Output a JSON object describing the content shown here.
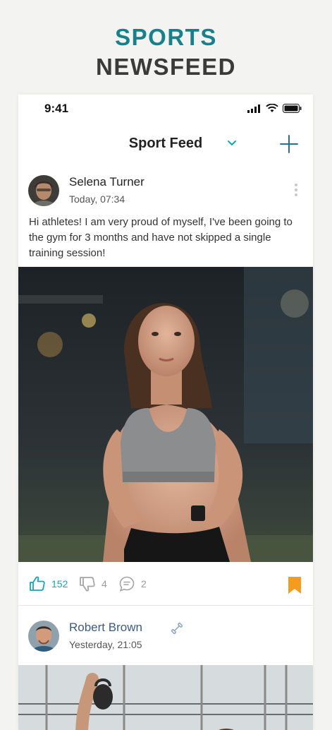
{
  "hero": {
    "line1": "SPORTS",
    "line2": "NEWSFEED"
  },
  "status_bar": {
    "time": "9:41",
    "icons": [
      "cellular-signal-icon",
      "wifi-icon",
      "battery-icon"
    ]
  },
  "nav": {
    "title": "Sport Feed",
    "dropdown_icon": "chevron-down-icon",
    "add_icon": "plus-icon"
  },
  "posts": [
    {
      "author": "Selena Turner",
      "timestamp": "Today, 07:34",
      "text": "Hi athletes! I am very proud of myself, I've been going to the gym for 3 months and have not skipped a single training session!",
      "likes": "152",
      "dislikes": "4",
      "comments": "2",
      "bookmarked": true
    },
    {
      "author": "Robert Brown",
      "timestamp": "Yesterday, 21:05",
      "badge_icon": "dumbbell-icon"
    }
  ],
  "colors": {
    "accent": "#19a3b3",
    "title_teal": "#17808a",
    "bookmark": "#f39c1e",
    "muted": "#9a9a9a"
  }
}
